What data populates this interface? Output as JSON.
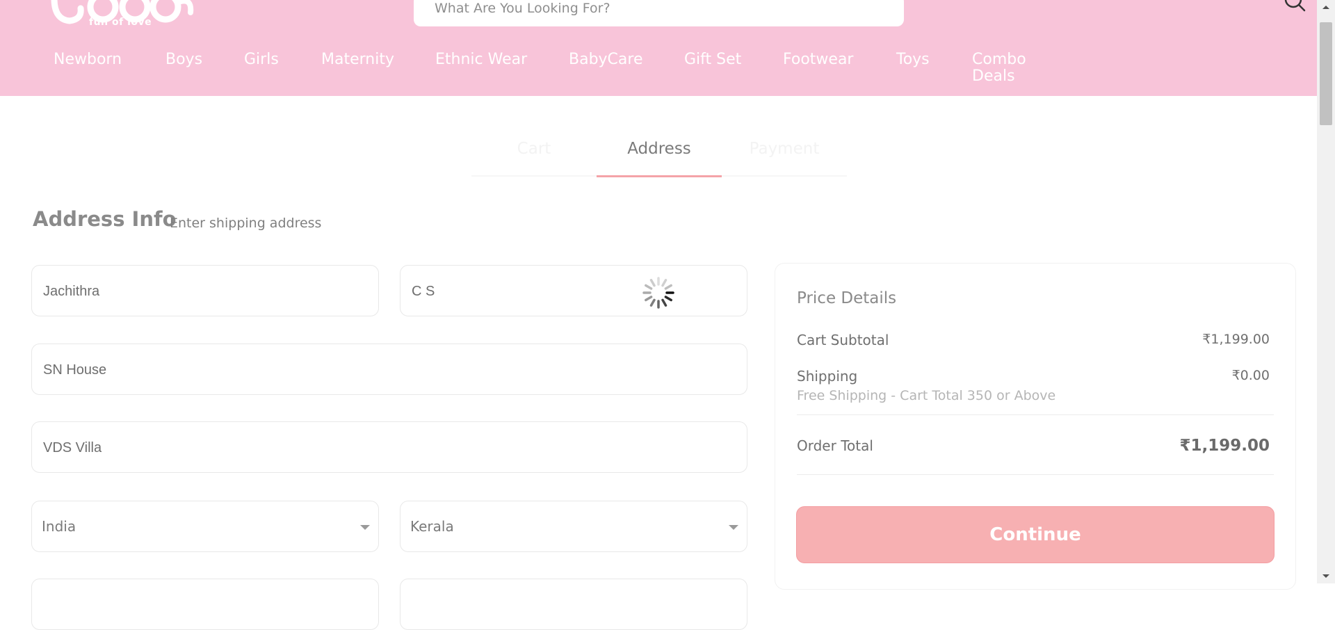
{
  "header": {
    "logo_tagline": "full of love",
    "search": {
      "placeholder": "What Are You Looking For?"
    },
    "nav": [
      {
        "label": "Newborn"
      },
      {
        "label": "Boys"
      },
      {
        "label": "Girls"
      },
      {
        "label": "Maternity"
      },
      {
        "label": "Ethnic Wear"
      },
      {
        "label": "BabyCare"
      },
      {
        "label": "Gift Set"
      },
      {
        "label": "Footwear"
      },
      {
        "label": "Toys"
      },
      {
        "label": "Combo\nDeals"
      }
    ]
  },
  "steps": [
    {
      "label": "Cart",
      "state": "done"
    },
    {
      "label": "Address",
      "state": "active"
    },
    {
      "label": "Payment",
      "state": "pending"
    }
  ],
  "address": {
    "title": "Address Info",
    "subtitle": "Enter shipping address",
    "first_name": "Jachithra",
    "last_name": "C S",
    "address_line1": "SN House",
    "address_line2": "VDS Villa",
    "country": "India",
    "state": "Kerala"
  },
  "price_details": {
    "title": "Price Details",
    "cart_subtotal_label": "Cart Subtotal",
    "cart_subtotal_value": "₹1,199.00",
    "shipping_label": "Shipping",
    "shipping_value": "₹0.00",
    "shipping_note": "Free Shipping - Cart Total 350 or Above",
    "order_total_label": "Order Total",
    "order_total_value": "₹1,199.00",
    "continue_label": "Continue"
  },
  "colors": {
    "header_bg": "#f8c4d9",
    "accent": "#f4a3a8",
    "button_bg": "#f7b0b2"
  }
}
